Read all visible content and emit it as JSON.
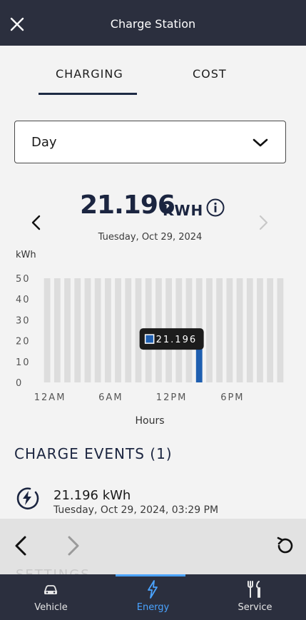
{
  "header": {
    "title": "Charge Station"
  },
  "tabs": [
    {
      "label": "CHARGING",
      "active": true
    },
    {
      "label": "COST",
      "active": false
    }
  ],
  "period_select": {
    "value": "Day"
  },
  "summary": {
    "total": "21.196",
    "unit": "KWH",
    "date": "Tuesday, Oct 29, 2024"
  },
  "chart_data": {
    "type": "bar",
    "ylabel": "kWh",
    "xlabel": "Hours",
    "ylim": [
      0,
      50
    ],
    "yticks": [
      "50",
      "40",
      "30",
      "20",
      "10",
      "0"
    ],
    "xticks": [
      "12AM",
      "6AM",
      "12PM",
      "6PM"
    ],
    "categories": [
      "0",
      "1",
      "2",
      "3",
      "4",
      "5",
      "6",
      "7",
      "8",
      "9",
      "10",
      "11",
      "12",
      "13",
      "14",
      "15",
      "16",
      "17",
      "18",
      "19",
      "20",
      "21",
      "22",
      "23"
    ],
    "values": [
      0,
      0,
      0,
      0,
      0,
      0,
      0,
      0,
      0,
      0,
      0,
      0,
      0,
      0,
      0,
      21.196,
      0,
      0,
      0,
      0,
      0,
      0,
      0,
      0
    ],
    "tooltip": "21.196",
    "bar_color": "#1f5fb0",
    "track_color": "#dddddd"
  },
  "events": {
    "title": "CHARGE EVENTS (1)",
    "items": [
      {
        "kwh": "21.196 kWh",
        "datetime": "Tuesday, Oct 29, 2024, 03:29 PM"
      }
    ]
  },
  "ghost_section": "SETTINGS",
  "bottom_nav": [
    {
      "label": "Vehicle",
      "icon": "car-icon",
      "active": false
    },
    {
      "label": "Energy",
      "icon": "bolt-icon",
      "active": true
    },
    {
      "label": "Service",
      "icon": "tools-icon",
      "active": false
    }
  ],
  "colors": {
    "header_bg": "#2b2f3e",
    "accent": "#4aa3ff",
    "title_navy": "#1b2540"
  }
}
